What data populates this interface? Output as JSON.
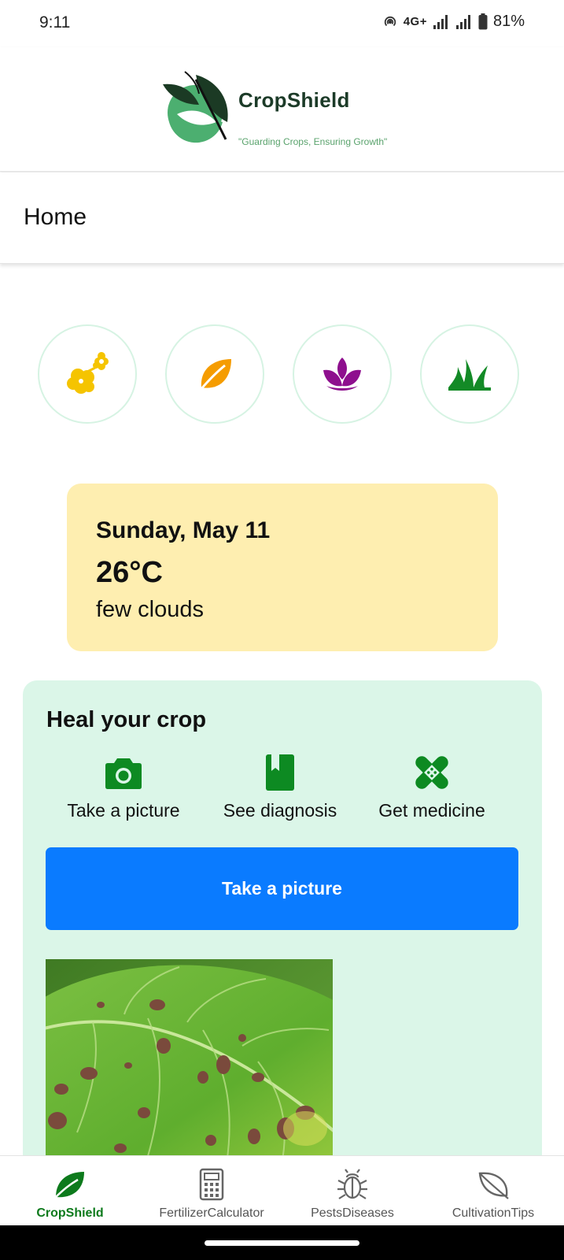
{
  "status_bar": {
    "time": "9:11",
    "network": "4G+",
    "battery": "81%"
  },
  "header": {
    "app_name": "CropShield",
    "tagline": "\"Guarding Crops, Ensuring Growth\""
  },
  "page": {
    "title": "Home"
  },
  "crop_categories": [
    {
      "icon": "flowers-icon",
      "color": "#f5c400"
    },
    {
      "icon": "leaf-icon",
      "color": "#f59c00"
    },
    {
      "icon": "lotus-icon",
      "color": "#8e0f8e"
    },
    {
      "icon": "grass-icon",
      "color": "#138a26"
    }
  ],
  "weather": {
    "date": "Sunday, May 11",
    "temperature": "26°C",
    "description": "few clouds"
  },
  "heal": {
    "title": "Heal your crop",
    "steps": [
      {
        "label": "Take a picture",
        "icon": "camera-icon"
      },
      {
        "label": "See diagnosis",
        "icon": "book-icon"
      },
      {
        "label": "Get medicine",
        "icon": "bandage-icon"
      }
    ],
    "button_label": "Take a picture"
  },
  "bottom_nav": [
    {
      "label": "CropShield",
      "icon": "leaf-nav-icon",
      "active": true
    },
    {
      "label": "FertilizerCalculator",
      "icon": "calculator-icon",
      "active": false
    },
    {
      "label": "PestsDiseases",
      "icon": "bug-icon",
      "active": false
    },
    {
      "label": "CultivationTips",
      "icon": "leaf-outline-icon",
      "active": false
    }
  ],
  "colors": {
    "accent_green": "#0d7a1c",
    "button_blue": "#0a7bff",
    "weather_card": "#feeeb0",
    "heal_card": "#dbf6e8"
  }
}
